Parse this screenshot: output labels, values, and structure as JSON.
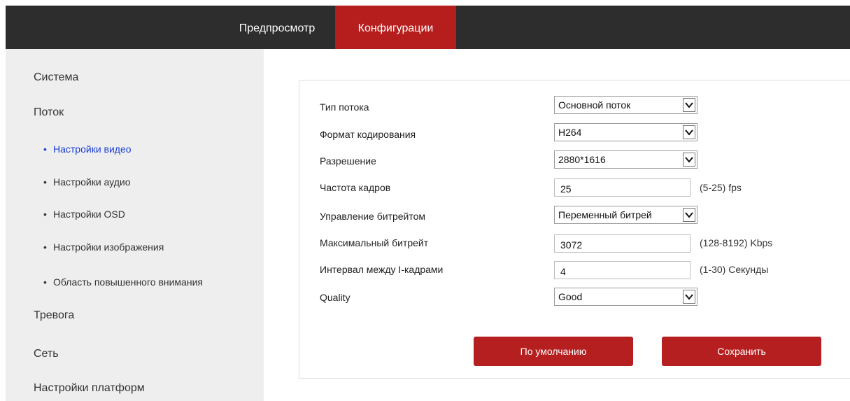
{
  "topnav": {
    "tabs": [
      {
        "label": "Предпросмотр"
      },
      {
        "label": "Конфигурации"
      }
    ]
  },
  "sidebar": {
    "items": [
      {
        "label": "Система"
      },
      {
        "label": "Поток"
      },
      {
        "label": "Настройки видео"
      },
      {
        "label": "Настройки аудио"
      },
      {
        "label": "Настройки OSD"
      },
      {
        "label": "Настройки изображения"
      },
      {
        "label": "Область повышенного внимания"
      },
      {
        "label": "Тревога"
      },
      {
        "label": "Сеть"
      },
      {
        "label": "Настройки платформ"
      }
    ],
    "bullet": "•"
  },
  "form": {
    "stream_type": {
      "label": "Тип потока",
      "value": "Основной поток"
    },
    "encoding": {
      "label": "Формат кодирования",
      "value": "H264"
    },
    "resolution": {
      "label": "Разрешение",
      "value": "2880*1616"
    },
    "framerate": {
      "label": "Частота кадров",
      "value": "25",
      "hint": "(5-25) fps"
    },
    "bitrate_control": {
      "label": "Управление битрейтом",
      "value": "Переменный битрей"
    },
    "max_bitrate": {
      "label": "Максимальный битрейт",
      "value": "3072",
      "hint": "(128-8192) Kbps"
    },
    "iframe_interval": {
      "label": "Интервал между I-кадрами",
      "value": "4",
      "hint": "(1-30) Секунды"
    },
    "quality": {
      "label": "Quality",
      "value": "Good"
    }
  },
  "buttons": {
    "default_label": "По умолчанию",
    "save_label": "Сохранить"
  },
  "colors": {
    "accent": "#b61d1d",
    "topbar": "#2d2d2d",
    "sidebar_bg": "#eeeeee",
    "active_link": "#1a3fd6"
  }
}
